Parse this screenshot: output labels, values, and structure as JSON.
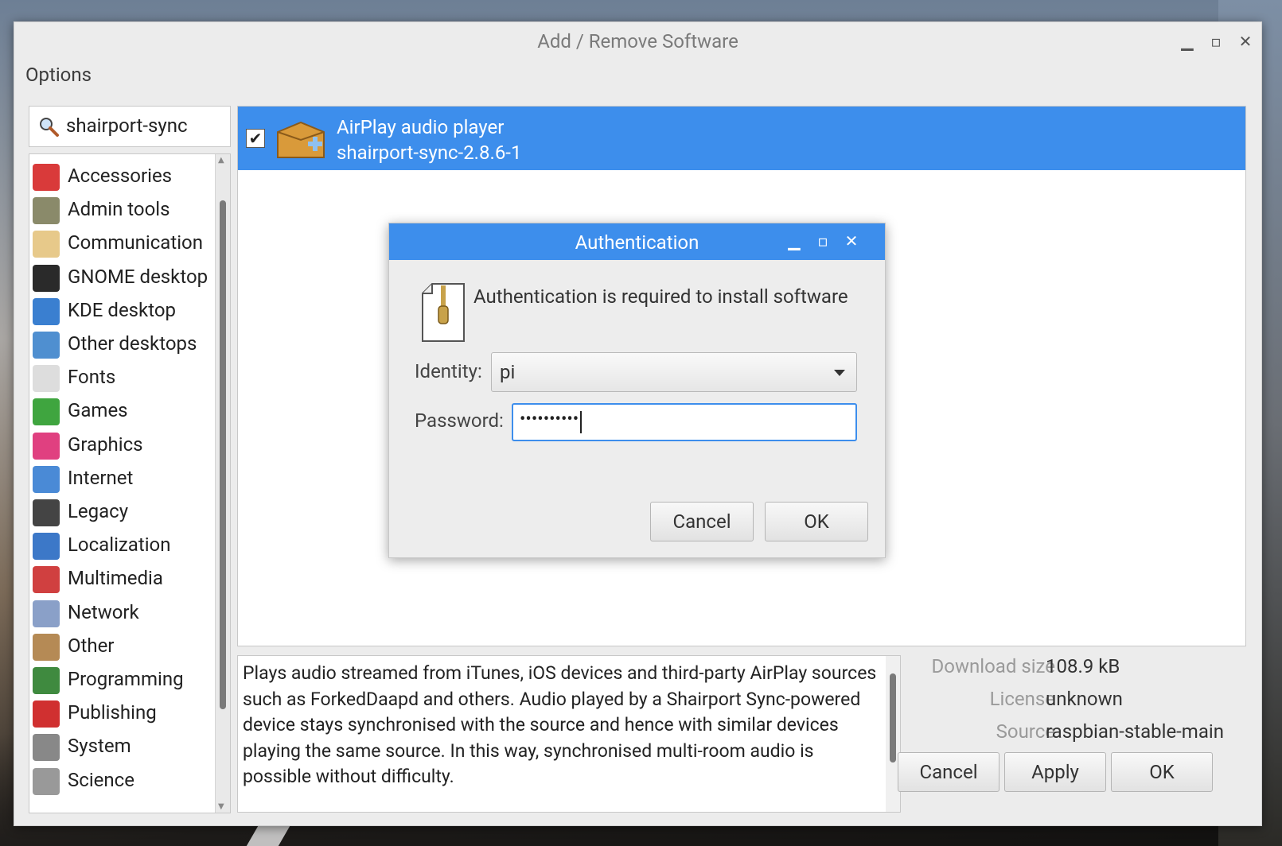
{
  "window": {
    "title": "Add / Remove Software",
    "minimize_glyph": "▁",
    "maximize_glyph": "▫",
    "close_glyph": "✕"
  },
  "menu": {
    "options": "Options"
  },
  "search": {
    "value": "shairport-sync",
    "icon": "search-icon"
  },
  "categories": [
    {
      "label": "Accessories",
      "icon": "accessories-icon",
      "color": "#d93a3a"
    },
    {
      "label": "Admin tools",
      "icon": "admin-tools-icon",
      "color": "#8a8a6a"
    },
    {
      "label": "Communication",
      "icon": "communication-icon",
      "color": "#e7c98a"
    },
    {
      "label": "GNOME desktop",
      "icon": "gnome-icon",
      "color": "#2a2a2a"
    },
    {
      "label": "KDE desktop",
      "icon": "kde-icon",
      "color": "#3a7fd0"
    },
    {
      "label": "Other desktops",
      "icon": "other-desktops-icon",
      "color": "#4f8fd0"
    },
    {
      "label": "Fonts",
      "icon": "fonts-icon",
      "color": "#dddddd"
    },
    {
      "label": "Games",
      "icon": "games-icon",
      "color": "#3fa53f"
    },
    {
      "label": "Graphics",
      "icon": "graphics-icon",
      "color": "#e04080"
    },
    {
      "label": "Internet",
      "icon": "internet-icon",
      "color": "#4a8ad6"
    },
    {
      "label": "Legacy",
      "icon": "legacy-icon",
      "color": "#444444"
    },
    {
      "label": "Localization",
      "icon": "localization-icon",
      "color": "#3c78c8"
    },
    {
      "label": "Multimedia",
      "icon": "multimedia-icon",
      "color": "#d04040"
    },
    {
      "label": "Network",
      "icon": "network-icon",
      "color": "#8aa0c8"
    },
    {
      "label": "Other",
      "icon": "other-icon",
      "color": "#b58a55"
    },
    {
      "label": "Programming",
      "icon": "programming-icon",
      "color": "#3f8a3f"
    },
    {
      "label": "Publishing",
      "icon": "publishing-icon",
      "color": "#d03030"
    },
    {
      "label": "System",
      "icon": "system-icon",
      "color": "#888888"
    },
    {
      "label": "Science",
      "icon": "science-icon",
      "color": "#999999"
    }
  ],
  "package": {
    "name": "AirPlay audio player",
    "version": "shairport-sync-2.8.6-1",
    "checked": "✔",
    "icon": "package-add-icon"
  },
  "description": "Plays audio streamed from iTunes, iOS devices and third-party AirPlay sources such as ForkedDaapd and others. Audio played by a Shairport Sync-powered device stays synchronised with the source and hence with similar devices playing the same source. In this way, synchronised multi-room audio is possible without difficulty.",
  "info": {
    "download_size_label": "Download size",
    "download_size": "108.9 kB",
    "license_label": "License",
    "license": "unknown",
    "source_label": "Source",
    "source": "raspbian-stable-main"
  },
  "buttons": {
    "cancel": "Cancel",
    "apply": "Apply",
    "ok": "OK"
  },
  "auth": {
    "title": "Authentication",
    "message": "Authentication is required to install software",
    "identity_label": "Identity:",
    "identity_value": "pi",
    "password_label": "Password:",
    "password_value": "••••••••••",
    "cancel": "Cancel",
    "ok": "OK",
    "minimize_glyph": "▁",
    "maximize_glyph": "▫",
    "close_glyph": "✕"
  },
  "colors": {
    "selection": "#3d8eec",
    "window_bg": "#ececec"
  }
}
